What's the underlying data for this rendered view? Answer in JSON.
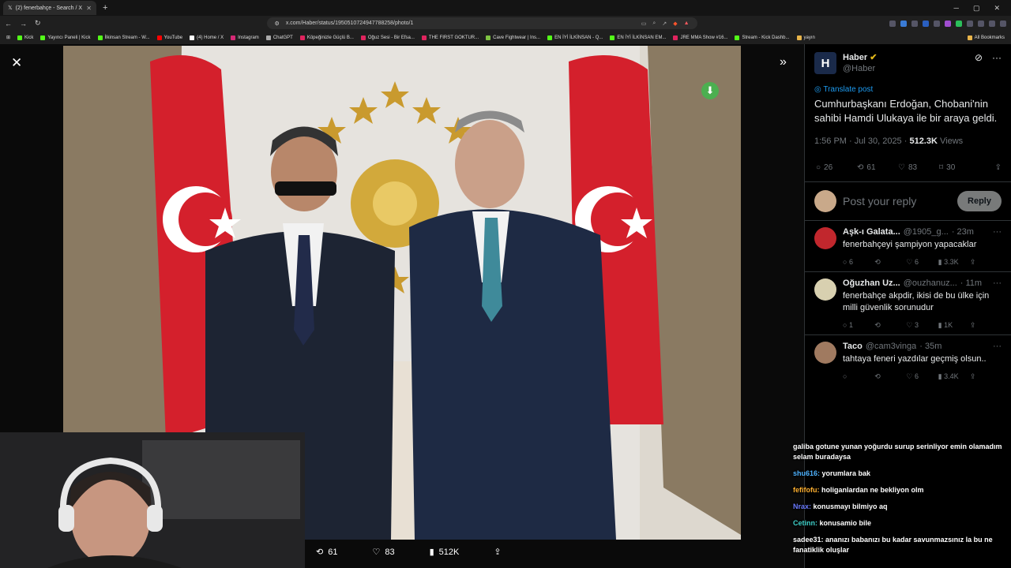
{
  "browser": {
    "tab_title": "(2) fenerbahçe - Search / X",
    "url": "x.com/Haber/status/1950510724947788258/photo/1",
    "bookmarks": [
      "Kick",
      "Yayıncı Paneli | Kick",
      "İlkinsan Stream - W...",
      "YouTube",
      "(4) Home / X",
      "Instagram",
      "ChatGPT",
      "Köpeğinizle Güçlü B...",
      "Oğuz Sesi - Bir Efsa...",
      "THE FIRST GOKTUR...",
      "Cave Fightwear | Ins...",
      "EN İYİ İLKİNSAN - Q...",
      "EN İYİ İLKİNSAN EM...",
      "JRE MMA Show #16...",
      "Stream - Kick Dashb...",
      "yayın"
    ],
    "all_bookmarks": "All Bookmarks"
  },
  "image_actions": {
    "retweets": "61",
    "likes": "83",
    "views": "512K"
  },
  "post": {
    "name": "Haber",
    "handle": "@Haber",
    "translate": "Translate post",
    "text": "Cumhurbaşkanı Erdoğan, Chobani'nin sahibi Hamdi Ulukaya ile bir araya geldi.",
    "time": "1:56 PM · Jul 30, 2025 · ",
    "views_count": "512.3K",
    "views_label": " Views",
    "replies": "26",
    "reposts": "61",
    "likes": "83",
    "bookmarks": "30",
    "reply_placeholder": "Post your reply",
    "reply_button": "Reply"
  },
  "comments": [
    {
      "name": "Aşk-ı Galata...",
      "handle": "@1905_g...",
      "time": "· 23m",
      "text": "fenerbahçeyi şampiyon yapacaklar",
      "replies": "6",
      "reposts": "",
      "likes": "6",
      "views": "3.3K",
      "avatar_color": "#c1272d"
    },
    {
      "name": "Oğuzhan Uz...",
      "handle": "@ouzhanuz...",
      "time": "· 11m",
      "text": "fenerbahçe akpdir, ikisi de bu ülke için milli güvenlik sorunudur",
      "replies": "1",
      "reposts": "",
      "likes": "3",
      "views": "1K",
      "avatar_color": "#d8d0b0"
    },
    {
      "name": "Taco",
      "handle": "@cam3vinga",
      "time": "· 35m",
      "text": "tahtaya feneri yazdılar geçmiş olsun..",
      "replies": "",
      "reposts": "",
      "likes": "6",
      "views": "3.4K",
      "avatar_color": "#a07a60"
    }
  ],
  "chat": [
    {
      "user": "",
      "text": "galiba gotune yunan yoğurdu surup serinliyor emin olamadım selam buradaysa",
      "color": "#ffffff"
    },
    {
      "user": "shu616:",
      "text": " yorumlara bak",
      "color": "#4fb3ff"
    },
    {
      "user": "fefifofu:",
      "text": " holiganlardan ne bekliyon olm",
      "color": "#ffb030"
    },
    {
      "user": "Nrax:",
      "text": " konusmayı bilmiyo aq",
      "color": "#6b7bff"
    },
    {
      "user": "Cetinn:",
      "text": " konusamio bile",
      "color": "#3fd0c9"
    },
    {
      "user": "sadee31:",
      "text": " ananızı babanızı bu kadar savunmazsınız la bu ne fanatiklik oluşlar",
      "color": "#ffffff"
    }
  ]
}
